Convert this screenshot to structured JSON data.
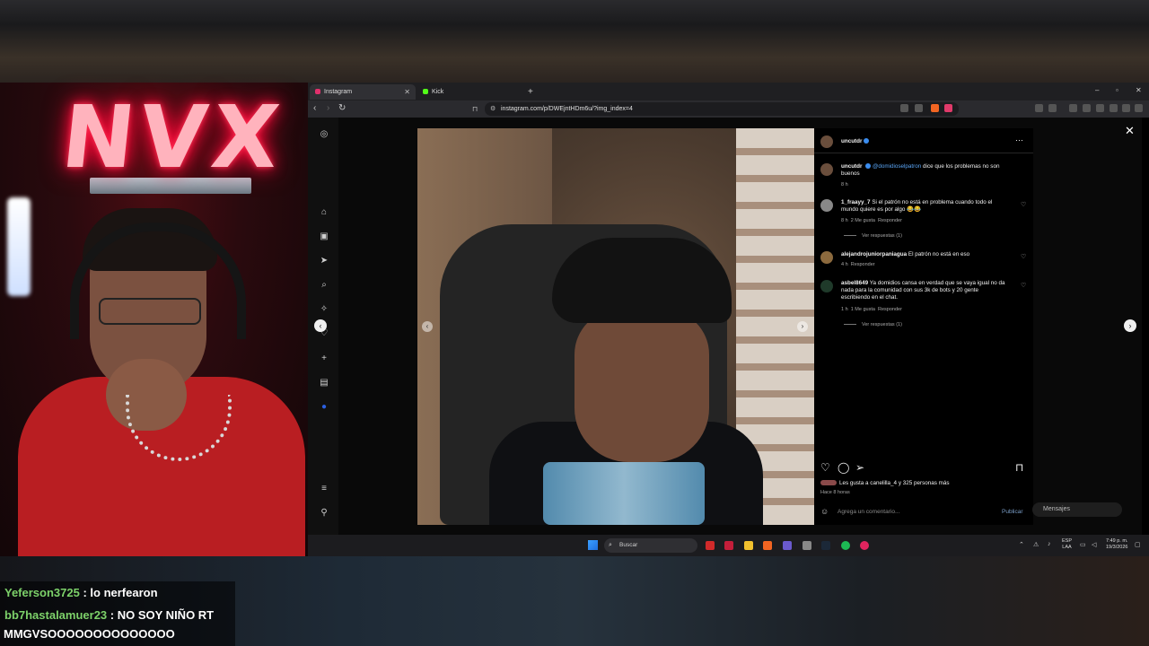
{
  "browser": {
    "tabs": [
      {
        "label": "Instagram",
        "icon": "instagram-icon",
        "color": "#e1306c"
      },
      {
        "label": "Kick",
        "icon": "kick-icon",
        "color": "#53fc18"
      }
    ],
    "url": "instagram.com/p/DWEjntHDm6u/?img_index=4"
  },
  "post": {
    "author": "uncutdr",
    "caption_author": "uncutdr",
    "caption_mention": "@domidioselpatron",
    "caption_text": "dice que los problemas no son buenos",
    "caption_time": "8 h",
    "comments": [
      {
        "user": "1_fraayy_7",
        "text": "Si el patrón no está en problema cuando todo el mundo quiere es por algo 😂😂",
        "time": "8 h",
        "likes": "2 Me gusta",
        "reply": "Responder",
        "replies": "Ver respuestas (1)"
      },
      {
        "user": "alejandrojuniorpaniagua",
        "text": "El patrón no está en eso",
        "time": "4 h",
        "likes": "",
        "reply": "Responder",
        "replies": ""
      },
      {
        "user": "asbel8649",
        "text": "Ya domidios cansa en verdad que se vaya igual no da nada para la comunidad con sus 3k de bots y 20 gente escribiendo en el chat.",
        "time": "1 h",
        "likes": "1 Me gusta",
        "reply": "Responder",
        "replies": "Ver respuestas (1)"
      }
    ],
    "likes_text": "Les gusta a canelilla_4 y 325 personas más",
    "likes_user": "canelilla_4",
    "posted": "Hace 8 horas",
    "comment_placeholder": "Agrega un comentario...",
    "publish": "Publicar",
    "messages": "Mensajes"
  },
  "taskbar": {
    "search": "Buscar",
    "lang_top": "ESP",
    "lang_bottom": "LAA",
    "time": "7:49 p. m.",
    "date": "19/3/2026"
  },
  "stream": {
    "logo": "NVX",
    "chat": [
      {
        "user": "Yeferson3725",
        "message": ": lo nerfearon"
      },
      {
        "user": "bb7hastalamuer23",
        "message": ": NO SOY NIÑO RT"
      },
      {
        "user": "",
        "message": "MMGVSOOOOOOOOOOOOOO"
      }
    ]
  },
  "colors": {
    "accent": "#3b8df0",
    "chat_username": "#7dd26a",
    "neon": "#ff1040"
  }
}
